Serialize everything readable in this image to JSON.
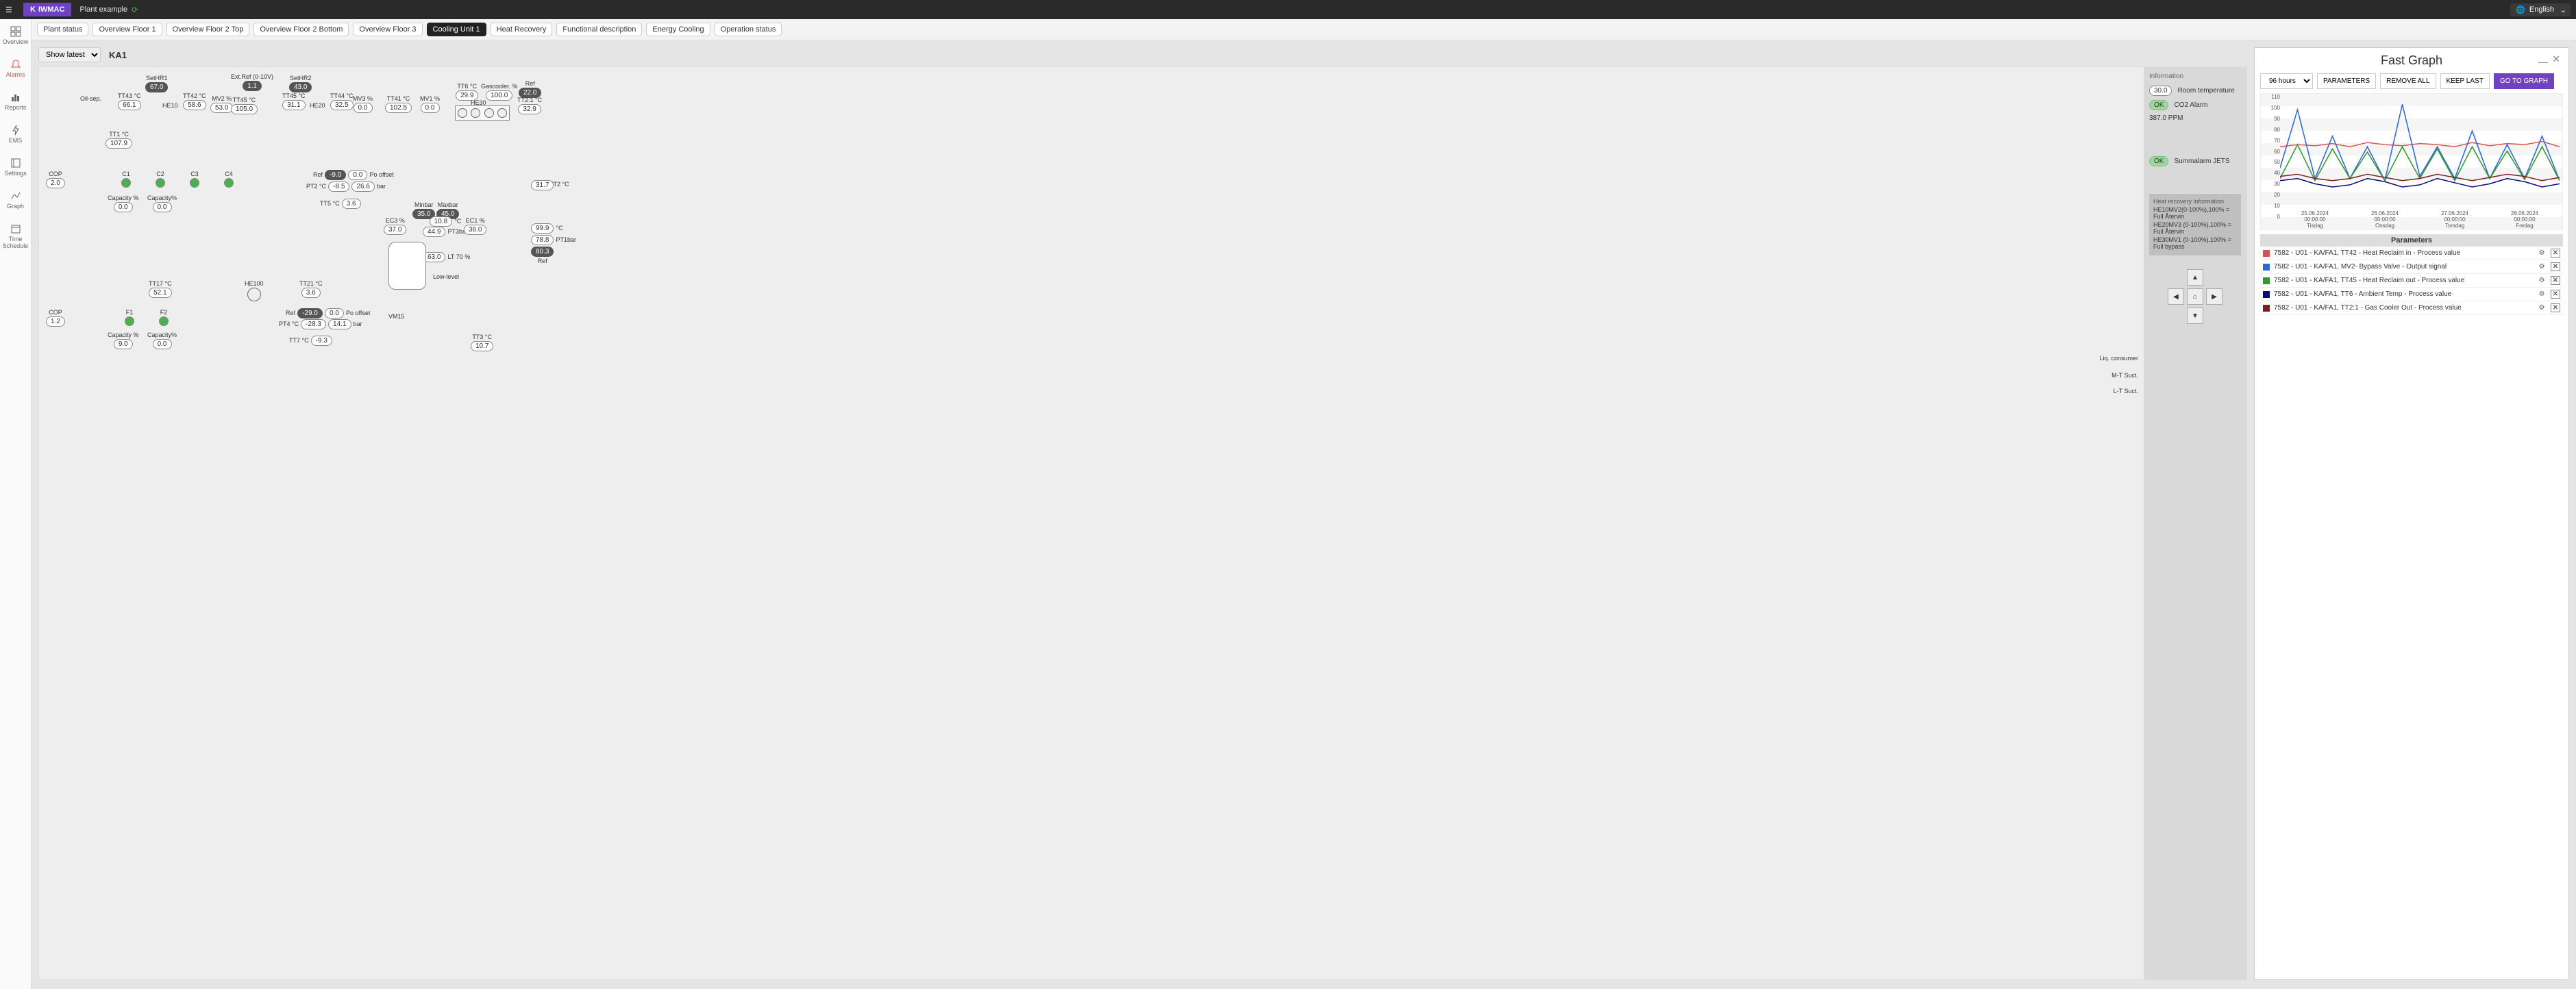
{
  "brand": "IWMAC",
  "plant_name": "Plant example",
  "language": "English",
  "leftnav": [
    {
      "label": "Overview"
    },
    {
      "label": "Alarms"
    },
    {
      "label": "Reports"
    },
    {
      "label": "EMS"
    },
    {
      "label": "Settings"
    },
    {
      "label": "Graph"
    },
    {
      "label": "Time Schedule"
    }
  ],
  "tabs": [
    {
      "label": "Plant status"
    },
    {
      "label": "Overview Floor 1"
    },
    {
      "label": "Overview Floor 2 Top"
    },
    {
      "label": "Overview Floor 2 Bottom"
    },
    {
      "label": "Overview Floor 3"
    },
    {
      "label": "Cooling Unit 1",
      "active": true
    },
    {
      "label": "Heat Recovery"
    },
    {
      "label": "Functional description"
    },
    {
      "label": "Energy Cooling"
    },
    {
      "label": "Operation status"
    }
  ],
  "show_select": "Show latest",
  "unit": "KA1",
  "info": {
    "heading": "Information",
    "room_temp_label": "Room temperature",
    "room_temp": "30.0",
    "co2_label": "CO2 Alarm",
    "co2_status": "OK",
    "co2_val": "387.0  PPM",
    "summ_label": "Summalarm JETS",
    "summ_status": "OK"
  },
  "heat_recovery": {
    "title": "Heat recovery information",
    "lines": [
      "HE10MV2(0-100%),100% = Full Återvin",
      "HE20MV3 (0-100%),100% = Full Återvin",
      "HE30MV1 (0-100%),100% = Full bypass"
    ]
  },
  "diagram": {
    "oil_sep": "Oil-sep.",
    "setHR1": {
      "label": "SetHR1",
      "sp": "67.0"
    },
    "tt43": {
      "label": "TT43 °C",
      "v": "66.1"
    },
    "he10": "HE10",
    "tt42": {
      "label": "TT42 °C",
      "v": "58.6"
    },
    "mv2": {
      "label": "MV2 %",
      "v": "53.0"
    },
    "extref": {
      "label": "Ext.Ref (0-10V)",
      "v": "1.1"
    },
    "tt45": {
      "label": "TT45 °C",
      "v": "105.0"
    },
    "setHR2": {
      "label": "SetHR2",
      "sp": "43.0"
    },
    "tt45b": {
      "label": "TT45 °C",
      "v": "31.1"
    },
    "he20": "HE20",
    "tt44": {
      "label": "TT44 °C",
      "v": "32.5"
    },
    "mv3": {
      "label": "MV3 %",
      "v": "0.0"
    },
    "tt41": {
      "label": "TT41 °C",
      "v": "102.5"
    },
    "mv1": {
      "label": "MV1 %",
      "v": "0.0"
    },
    "tt6": {
      "label": "TT6 °C",
      "v": "29.9"
    },
    "gascooler": {
      "label": "Gascooler. %",
      "v": "100.0"
    },
    "he30": "HE30",
    "ref22": {
      "label": "Ref",
      "v": "22.0"
    },
    "tt2_1": {
      "label": "TT2:1 °C",
      "v": "32.9"
    },
    "tt1": {
      "label": "TT1 °C",
      "v": "107.9"
    },
    "cop1": {
      "label": "COP",
      "v": "2.0"
    },
    "c_labels": [
      "C1",
      "C2",
      "C3",
      "C4"
    ],
    "cap1": {
      "label": "Capacity %",
      "v": "0.0"
    },
    "cap2": {
      "label": "Capacity%",
      "v": "0.0"
    },
    "refPo": {
      "label": "Ref",
      "v": "-9.0",
      "v2": "0.0",
      "v2l": "Po offset"
    },
    "pt2": {
      "label": "PT2 °C",
      "v": "-8.5",
      "bar": "26.6",
      "barl": "bar"
    },
    "tt5": {
      "label": "TT5 °C",
      "v": "3.6"
    },
    "tt2": {
      "label": "TT2 °C",
      "v": "31.7"
    },
    "minmax": {
      "min_l": "Minbar",
      "min": "35.0",
      "max_l": "Maxbar",
      "max": "45.0"
    },
    "ec3": {
      "label": "EC3 %",
      "v": "37.0"
    },
    "pt3": {
      "label": "PT3bar",
      "v1": "10.8",
      "v2": "44.9"
    },
    "ec1": {
      "label": "EC1 %",
      "v": "38.0"
    },
    "val99": "99.9",
    "val99l": "°C",
    "pt1": {
      "label": "PT1bar",
      "v": "78.8"
    },
    "ref_bot": {
      "label": "Ref",
      "v": "80.3"
    },
    "lt": {
      "label": "LT 70 %",
      "v": "63.0"
    },
    "lowlevel": "Low-level",
    "tt17": {
      "label": "TT17 °C",
      "v": "52.1"
    },
    "he100": "HE100",
    "tt21": {
      "label": "TT21 °C",
      "v": "3.6"
    },
    "cop2": {
      "label": "COP",
      "v": "1.2"
    },
    "f_labels": [
      "F1",
      "F2"
    ],
    "cap3": {
      "label": "Capacity %",
      "v": "9.0"
    },
    "cap4": {
      "label": "Capacity%",
      "v": "0.0"
    },
    "refPo2": {
      "label": "Ref",
      "v": "-29.0",
      "v2": "0.0",
      "v2l": "Po offset"
    },
    "pt4": {
      "label": "PT4 °C",
      "v": "-28.3",
      "bar": "14.1",
      "barl": "bar"
    },
    "tt7": {
      "label": "TT7 °C",
      "v": "-9.3"
    },
    "vm15": "VM15",
    "tt3": {
      "label": "TT3 °C",
      "v": "10.7"
    },
    "liq": "Liq. consumer",
    "mt": "M-T Suct.",
    "ls": "L-T Suct."
  },
  "fast_graph": {
    "title": "Fast Graph",
    "range": "96 hours",
    "buttons": {
      "params": "PARAMETERS",
      "remove": "REMOVE ALL",
      "keep": "KEEP LAST",
      "go": "GO TO GRAPH"
    },
    "param_header": "Parameters",
    "params": [
      {
        "color": "#d9534f",
        "label": "7582 - U01 - KA/FA1, TT42 - Heat Reclaim in - Process value"
      },
      {
        "color": "#2e65d9",
        "label": "7582 - U01 - KA/FA1, MV2- Bypass Valve - Output signal"
      },
      {
        "color": "#2c9a2c",
        "label": "7582 - U01 - KA/FA1, TT45 - Heat Reclaim out - Process value"
      },
      {
        "color": "#0a0a7a",
        "label": "7582 - U01 - KA/FA1, TT6 - Ambient Temp - Process value"
      },
      {
        "color": "#7a1f1f",
        "label": "7582 - U01 - KA/FA1, TT2:1 - Gas Cooler Out - Process value"
      }
    ]
  },
  "chart_data": {
    "type": "line",
    "ylim": [
      0,
      110
    ],
    "yticks": [
      0,
      10,
      20,
      30,
      40,
      50,
      60,
      70,
      80,
      90,
      100,
      110
    ],
    "xticks": [
      {
        "l1": "25.06.2024",
        "l2": "00:00:00",
        "l3": "Tisdag"
      },
      {
        "l1": "26.06.2024",
        "l2": "00:00:00",
        "l3": "Onsdag"
      },
      {
        "l1": "27.06.2024",
        "l2": "00:00:00",
        "l3": "Torsdag"
      },
      {
        "l1": "28.06.2024",
        "l2": "00:00:00",
        "l3": "Fredag"
      }
    ],
    "series": [
      {
        "name": "TT42 Heat Reclaim in",
        "color": "#d9534f",
        "values": [
          60,
          62,
          61,
          63,
          60,
          64,
          62,
          61,
          63,
          62,
          60,
          64,
          61,
          63,
          62,
          65,
          60
        ]
      },
      {
        "name": "MV2 Bypass Valve",
        "color": "#2e65d9",
        "values": [
          40,
          95,
          30,
          70,
          30,
          60,
          28,
          100,
          32,
          60,
          30,
          75,
          30,
          62,
          30,
          70,
          28
        ]
      },
      {
        "name": "TT45 Heat Reclaim out",
        "color": "#2c9a2c",
        "values": [
          30,
          62,
          28,
          58,
          30,
          55,
          28,
          60,
          30,
          58,
          28,
          60,
          30,
          56,
          29,
          60,
          28
        ]
      },
      {
        "name": "TT6 Ambient",
        "color": "#0a0a7a",
        "values": [
          28,
          30,
          25,
          22,
          24,
          30,
          27,
          22,
          24,
          30,
          26,
          22,
          25,
          30,
          27,
          22,
          25
        ]
      },
      {
        "name": "TT2:1 Gas Cooler Out",
        "color": "#7a1f1f",
        "values": [
          32,
          34,
          30,
          28,
          30,
          34,
          31,
          28,
          30,
          34,
          31,
          28,
          31,
          34,
          32,
          28,
          31
        ]
      }
    ]
  }
}
